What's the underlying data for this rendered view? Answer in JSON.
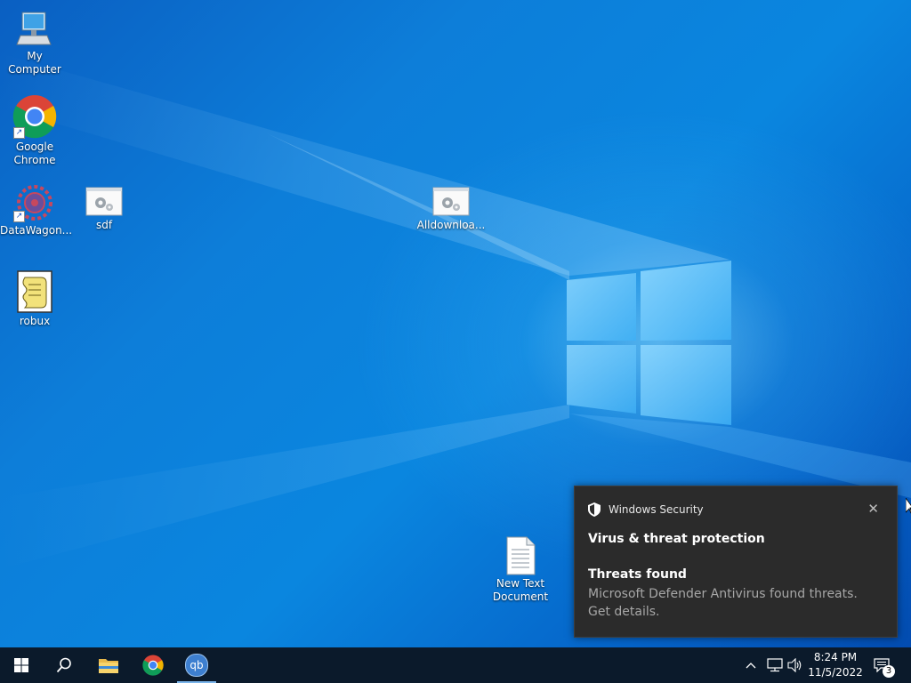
{
  "desktop": {
    "icons": {
      "my_computer": "My Computer",
      "chrome_line1": "Google",
      "chrome_line2": "Chrome",
      "datawagon": "DataWagon...",
      "sdf": "sdf",
      "alldownload": "Alldownloa...",
      "robux": "robux",
      "new_text_line1": "New Text",
      "new_text_line2": "Document"
    }
  },
  "toast": {
    "app": "Windows Security",
    "title": "Virus & threat protection",
    "subtitle": "Threats found",
    "body": "Microsoft Defender Antivirus found threats. Get details.",
    "close": "✕"
  },
  "taskbar": {
    "time": "8:24 PM",
    "date": "11/5/2022",
    "notification_count": "3",
    "qb_label": "qb"
  },
  "colors": {
    "taskbar": "#0b1a2b",
    "toast_bg": "#2b2b2b",
    "desktop_accent": "#0a86df"
  }
}
